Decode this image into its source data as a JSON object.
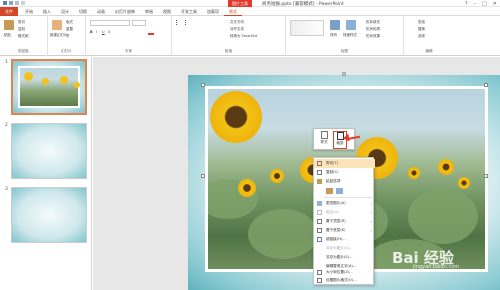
{
  "window": {
    "title": "商务短报.pptx [兼容模式] - PowerPoint",
    "context_group": "图片工具",
    "controls": [
      "?",
      "–",
      "□",
      "✕"
    ]
  },
  "tabs": [
    {
      "label": "文件"
    },
    {
      "label": "开始"
    },
    {
      "label": "插入"
    },
    {
      "label": "设计"
    },
    {
      "label": "切换"
    },
    {
      "label": "动画"
    },
    {
      "label": "幻灯片放映"
    },
    {
      "label": "审阅"
    },
    {
      "label": "视图"
    },
    {
      "label": "开发工具"
    },
    {
      "label": "加载项"
    },
    {
      "label": "格式"
    }
  ],
  "ribbon": {
    "clipboard": {
      "label": "剪贴板",
      "paste": "粘贴",
      "cut": "剪切",
      "copy": "复制",
      "format_painter": "格式刷"
    },
    "slides": {
      "label": "幻灯片",
      "new_slide": "新建幻灯片",
      "layout": "版式",
      "reset": "重置",
      "section": "节"
    },
    "font": {
      "label": "字体"
    },
    "paragraph": {
      "label": "段落",
      "text_direction": "文字方向",
      "align_text": "对齐文本",
      "smartart": "转换为 SmartArt"
    },
    "drawing": {
      "label": "绘图",
      "arrange": "排列",
      "quick_styles": "快速样式",
      "shape_fill": "形状填充",
      "shape_outline": "形状轮廓",
      "shape_effects": "形状效果"
    },
    "editing": {
      "label": "编辑",
      "find": "查找",
      "replace": "替换",
      "select": "选择"
    }
  },
  "slides": [
    {
      "number": "1"
    },
    {
      "number": "2"
    },
    {
      "number": "3"
    }
  ],
  "minitoolbar": [
    {
      "label": "样式"
    },
    {
      "label": "裁剪"
    }
  ],
  "context_menu": [
    {
      "label": "剪切(T)",
      "state": "active"
    },
    {
      "label": "复制(C)",
      "state": "normal"
    },
    {
      "label": "粘贴选项:",
      "state": "normal"
    },
    {
      "label": "",
      "state": "normal"
    },
    {
      "label": "更改图片(A)",
      "state": "normal",
      "submenu": true
    },
    {
      "label": "组合(G)",
      "state": "disabled",
      "submenu": true
    },
    {
      "label": "置于顶层(R)",
      "state": "normal",
      "submenu": true
    },
    {
      "label": "置于底层(K)",
      "state": "normal",
      "submenu": true
    },
    {
      "label": "超链接(H)...",
      "state": "normal"
    },
    {
      "label": "另存为图片(S)...",
      "state": "disabled"
    },
    {
      "label": "另存为图片(S)...",
      "state": "normal"
    },
    {
      "label": "编辑替换文字(A)...",
      "state": "normal"
    },
    {
      "label": "大小和位置(Z)...",
      "state": "normal"
    },
    {
      "label": "设置图片格式(O)...",
      "state": "normal"
    }
  ],
  "watermark": {
    "text": "Bai 经验",
    "sub": "jingyan.baidu.com"
  }
}
